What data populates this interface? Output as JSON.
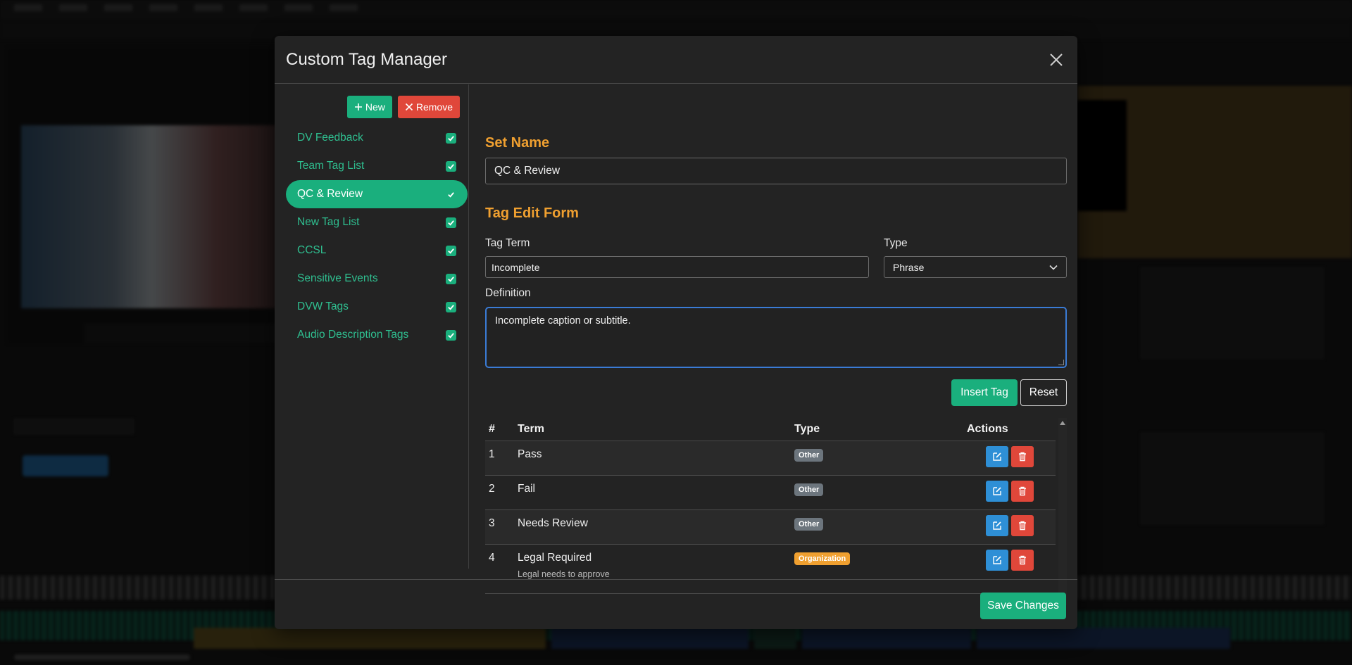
{
  "modal": {
    "title": "Custom Tag Manager"
  },
  "sidebar": {
    "new_label": "New",
    "remove_label": "Remove",
    "items": [
      {
        "label": "DV Feedback",
        "checked": true
      },
      {
        "label": "Team Tag List",
        "checked": true
      },
      {
        "label": "QC & Review",
        "checked": true,
        "active": true
      },
      {
        "label": "New Tag List",
        "checked": true
      },
      {
        "label": "CCSL",
        "checked": true
      },
      {
        "label": "Sensitive Events",
        "checked": true
      },
      {
        "label": "DVW Tags",
        "checked": true
      },
      {
        "label": "Audio Description Tags",
        "checked": true
      }
    ]
  },
  "form": {
    "set_name_heading": "Set Name",
    "set_name_value": "QC & Review",
    "edit_heading": "Tag Edit Form",
    "term_label": "Tag Term",
    "term_value": "Incomplete",
    "type_label": "Type",
    "type_value": "Phrase",
    "definition_label": "Definition",
    "definition_value": "Incomplete caption or subtitle.",
    "insert_label": "Insert Tag",
    "reset_label": "Reset"
  },
  "table": {
    "headers": {
      "num": "#",
      "term": "Term",
      "type": "Type",
      "actions": "Actions"
    },
    "rows": [
      {
        "num": "1",
        "term": "Pass",
        "type": "Other",
        "definition": ""
      },
      {
        "num": "2",
        "term": "Fail",
        "type": "Other",
        "definition": ""
      },
      {
        "num": "3",
        "term": "Needs Review",
        "type": "Other",
        "definition": ""
      },
      {
        "num": "4",
        "term": "Legal Required",
        "type": "Organization",
        "definition": "Legal needs to approve"
      }
    ]
  },
  "footer": {
    "save_label": "Save Changes"
  },
  "colors": {
    "accent_green": "#1aaf7d",
    "danger_red": "#e0473a",
    "heading_orange": "#f0a030",
    "edit_blue": "#2e8fd6",
    "badge_other": "#6c757d",
    "badge_organization": "#f0a030"
  }
}
